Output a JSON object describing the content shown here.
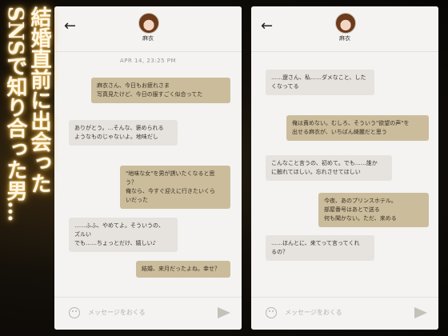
{
  "title_columns": [
    "結婚直前に出会った",
    "SNSで知り合った男…"
  ],
  "contact_name": "麻衣",
  "composer_placeholder": "メッセージをおくる",
  "phone1": {
    "timestamp": "APR 14, 23:25 PM",
    "messages": [
      "麻衣さん、今日もお疲れさま\n写真見たけど、今日の服すごく似合ってた",
      "ありがとう。…そんな、褒められる\nようなものじゃないよ。地味だし",
      "\"地味な女\"を男が誘いたくなると思\nう？\n俺なら、今すぐ迎えに行きたいくら\nいだった",
      "……ふふ、やめてよ。そういうの、\nズルい\nでも……ちょっとだけ、嬉しい♪",
      "結婚、来月だったよね。幸せ？"
    ]
  },
  "phone2": {
    "messages": [
      "……遼さん、私……ダメなこと、した\nくなってる",
      "俺は責めない。むしろ、そういう\"欲望の声\"を\n出せる麻衣が、いちばん綺麗だと思う",
      "こんなこと言うの、初めて。でも……誰か\nに触れてほしい。忘れさせてほしい",
      "今夜、あのプリンスホテル。\n部屋番号はあとで送る\n何も聞かない。ただ、来める",
      "……ほんとに、来てって言ってくれ\nるの？"
    ]
  }
}
